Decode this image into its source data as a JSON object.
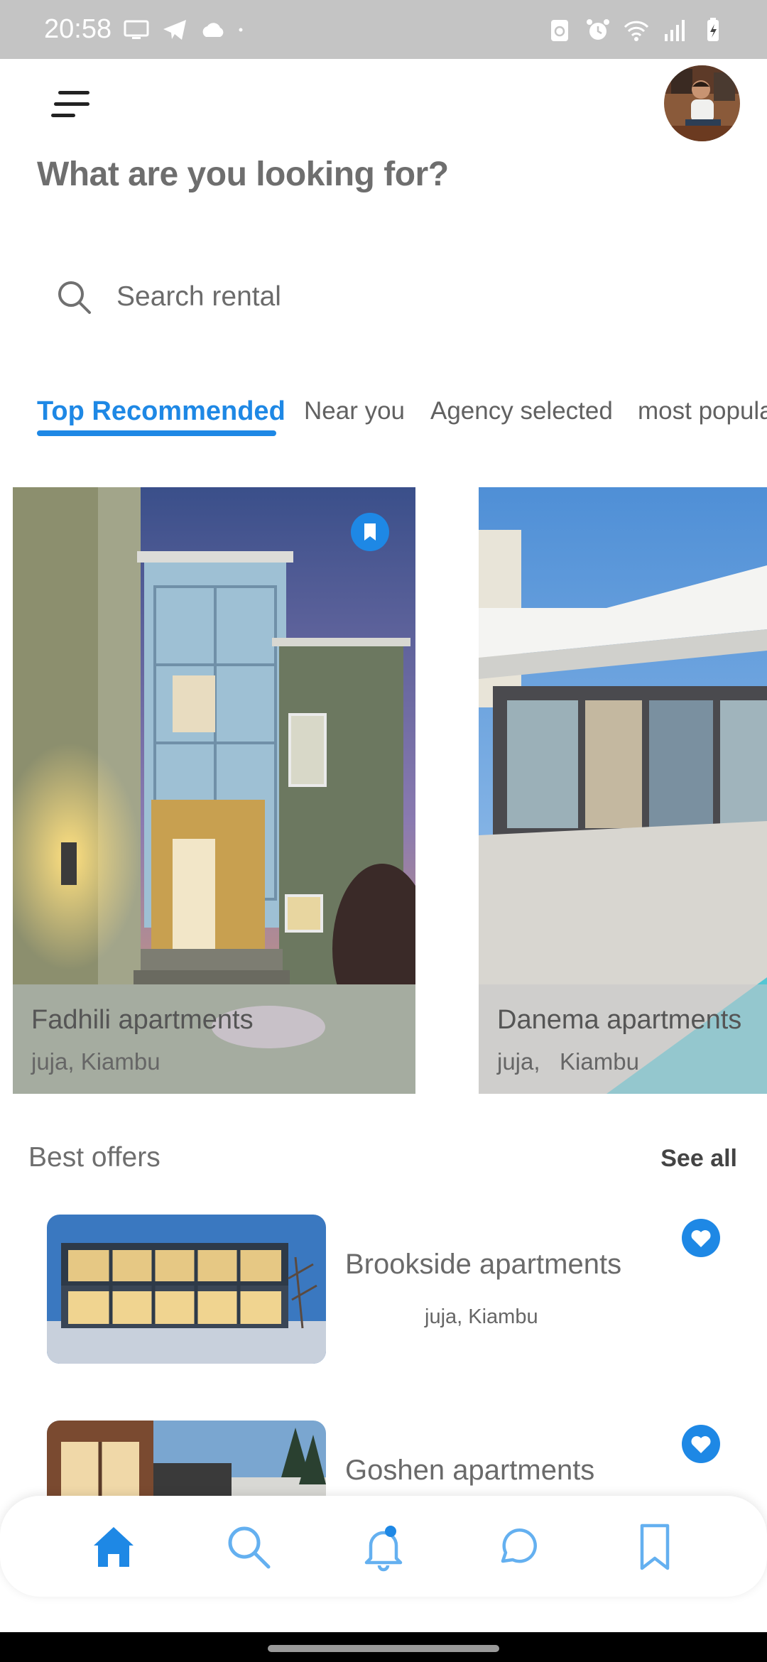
{
  "status_bar": {
    "time": "20:58",
    "left_icons": [
      "screen-cast-icon",
      "telegram-icon",
      "cloud-icon",
      "dot-icon"
    ],
    "right_icons": [
      "recycle-icon",
      "alarm-icon",
      "wifi-icon",
      "signal-icon",
      "battery-icon"
    ]
  },
  "header": {
    "menu_icon": "menu-icon",
    "avatar": "profile-avatar",
    "title": "What are you looking for?"
  },
  "search": {
    "placeholder": "Search rental",
    "value": ""
  },
  "tabs": [
    {
      "label": "Top Recommended",
      "active": true
    },
    {
      "label": "Near you",
      "active": false
    },
    {
      "label": "Agency selected",
      "active": false
    },
    {
      "label": "most popular",
      "active": false
    }
  ],
  "featured": [
    {
      "name": "Fadhili apartments",
      "location": "juja, Kiambu",
      "bookmarked": true
    },
    {
      "name": "Danema apartments",
      "location": "juja,   Kiambu",
      "bookmarked": false
    }
  ],
  "best_offers": {
    "title": "Best offers",
    "see_all": "See all",
    "items": [
      {
        "name": "Brookside apartments",
        "location": "juja, Kiambu",
        "favorite": true
      },
      {
        "name": "Goshen apartments",
        "location": "",
        "favorite": true
      }
    ]
  },
  "bottom_nav": [
    {
      "name": "home",
      "icon": "home-icon",
      "active": true
    },
    {
      "name": "search",
      "icon": "search-icon",
      "active": false
    },
    {
      "name": "notifications",
      "icon": "bell-icon",
      "active": false
    },
    {
      "name": "chat",
      "icon": "chat-icon",
      "active": false
    },
    {
      "name": "saved",
      "icon": "bookmark-icon",
      "active": false
    }
  ],
  "colors": {
    "accent": "#1e88e5",
    "status_bar": "#c4c4c4",
    "title_text": "#6e6e6e"
  }
}
